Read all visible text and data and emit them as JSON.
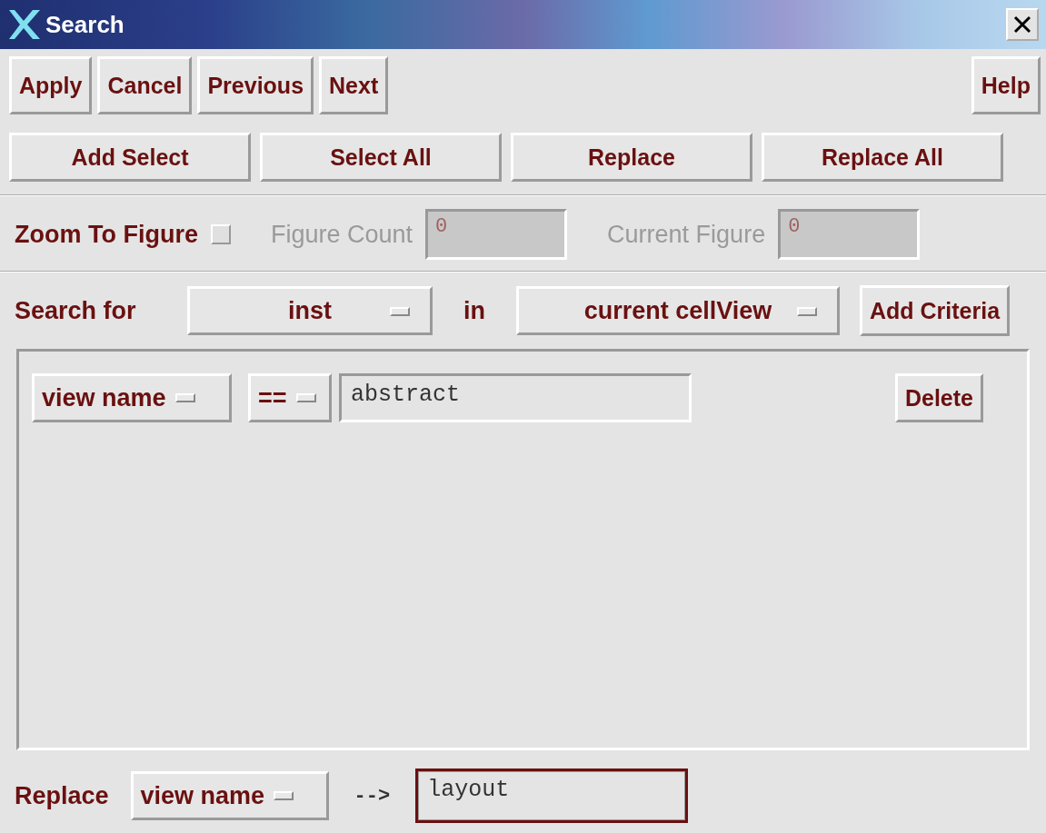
{
  "window": {
    "title": "Search"
  },
  "toolbar": {
    "left": [
      "Apply",
      "Cancel",
      "Previous",
      "Next"
    ],
    "right": [
      "Help"
    ]
  },
  "actions": [
    "Add Select",
    "Select All",
    "Replace",
    "Replace All"
  ],
  "zoom_to_figure": {
    "label": "Zoom To Figure",
    "checked": false
  },
  "counters": [
    {
      "label": "Figure Count",
      "value": "0",
      "disabled": true
    },
    {
      "label": "Current Figure",
      "value": "0",
      "disabled": true
    }
  ],
  "search": {
    "label": "Search for",
    "type": "inst",
    "in_label": "in",
    "scope": "current cellView",
    "add_button": "Add Criteria"
  },
  "criteria": [
    {
      "field": "view name",
      "operator": "==",
      "value": "abstract",
      "delete_button": "Delete"
    }
  ],
  "replace": {
    "label": "Replace",
    "field": "view name",
    "arrow": "-->",
    "value": "layout",
    "focused": true
  }
}
